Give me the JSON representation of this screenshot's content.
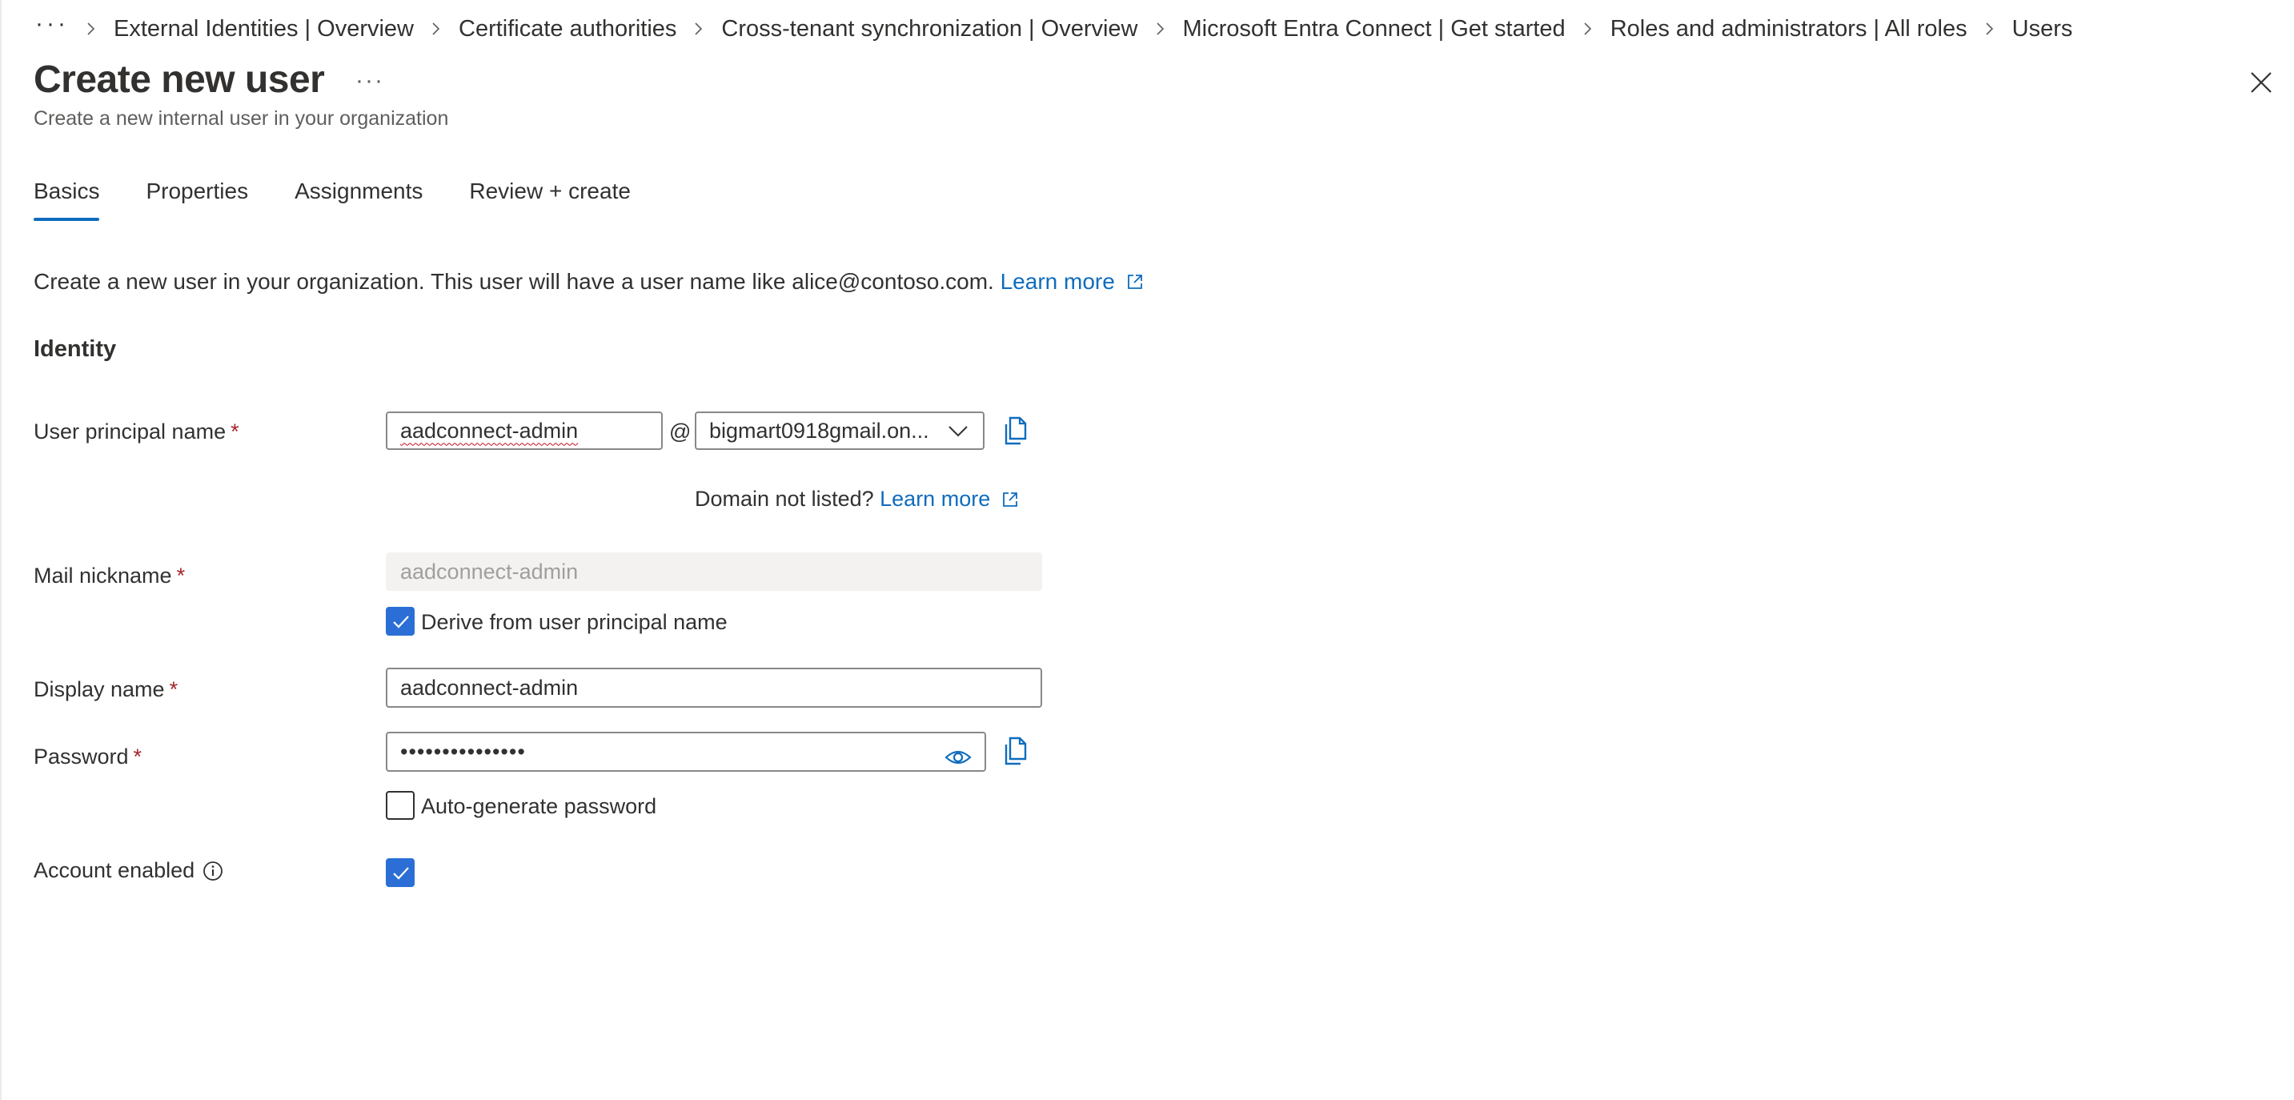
{
  "breadcrumb": {
    "more": "···",
    "items": [
      "External Identities | Overview",
      "Certificate authorities",
      "Cross-tenant synchronization | Overview",
      "Microsoft Entra Connect | Get started",
      "Roles and administrators | All roles",
      "Users"
    ]
  },
  "header": {
    "title": "Create new user",
    "more": "···",
    "subtitle": "Create a new internal user in your organization"
  },
  "tabs": [
    {
      "label": "Basics",
      "active": true
    },
    {
      "label": "Properties",
      "active": false
    },
    {
      "label": "Assignments",
      "active": false
    },
    {
      "label": "Review + create",
      "active": false
    }
  ],
  "intro": {
    "text": "Create a new user in your organization. This user will have a user name like alice@contoso.com.",
    "link": "Learn more"
  },
  "section": {
    "identity": "Identity"
  },
  "form": {
    "upn": {
      "label": "User principal name",
      "required": "*",
      "value": "aadconnect-admin",
      "at": "@",
      "domain": "bigmart0918gmail.on..."
    },
    "domain_note": {
      "text": "Domain not listed?",
      "link": "Learn more"
    },
    "mail_nickname": {
      "label": "Mail nickname",
      "required": "*",
      "value": "aadconnect-admin",
      "derive_label": "Derive from user principal name",
      "derive_checked": true
    },
    "display_name": {
      "label": "Display name",
      "required": "*",
      "value": "aadconnect-admin"
    },
    "password": {
      "label": "Password",
      "required": "*",
      "value": "•••••••••••••••",
      "auto_label": "Auto-generate password",
      "auto_checked": false
    },
    "account_enabled": {
      "label": "Account enabled",
      "checked": true
    }
  },
  "colors": {
    "accent": "#0f6cbd",
    "checkbox": "#2b6fd6",
    "required": "#a4262c"
  },
  "icons": [
    "close-icon",
    "external-link-icon",
    "copy-icon",
    "chevron-down-icon",
    "eye-icon",
    "info-icon",
    "checkmark-icon",
    "chevron-right-icon"
  ]
}
